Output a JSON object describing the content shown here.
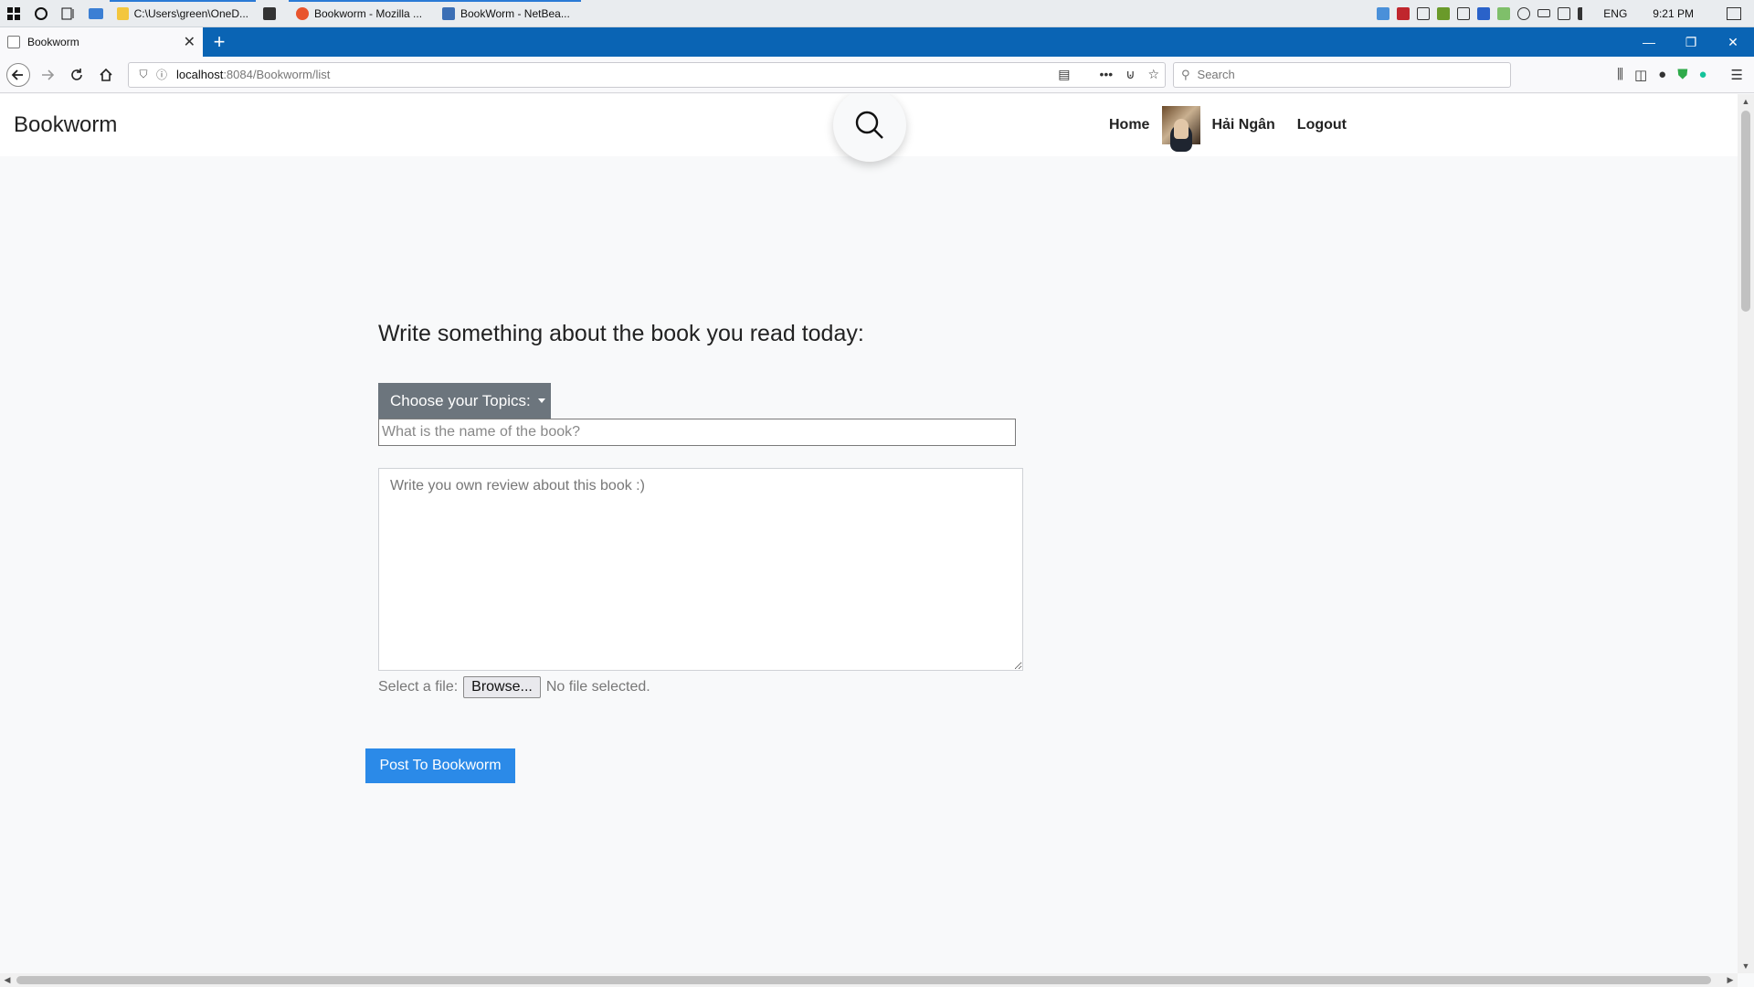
{
  "taskbar": {
    "apps": [
      {
        "label": "C:\\Users\\green\\OneD...",
        "icon": "folder-icon",
        "color": "#f3c63d",
        "active": true
      },
      {
        "label": "",
        "icon": "store-icon",
        "color": "#333333",
        "active": false
      },
      {
        "label": "Bookworm - Mozilla ...",
        "icon": "firefox-icon",
        "color": "#e8542d",
        "active": true
      },
      {
        "label": "BookWorm - NetBea...",
        "icon": "netbeans-icon",
        "color": "#3b6fb5",
        "active": true
      }
    ],
    "language": "ENG",
    "time": "9:21 PM"
  },
  "browser": {
    "tab_title": "Bookworm",
    "url_host": "localhost",
    "url_rest": ":8084/Bookworm/list",
    "search_placeholder": "Search"
  },
  "site": {
    "brand": "Bookworm",
    "nav": {
      "home": "Home",
      "user": "Hải Ngân",
      "logout": "Logout"
    }
  },
  "post_form": {
    "prompt": "Write something about the book you read today:",
    "topic_button": "Choose your Topics:",
    "book_placeholder": "What is the name of the book?",
    "review_placeholder": "Write you own review about this book :)",
    "file_label": "Select a file:",
    "browse_label": "Browse...",
    "file_status": "No file selected.",
    "submit_label": "Post To Bookworm"
  },
  "colors": {
    "tabstrip": "#0a64b4",
    "topic_button": "#6c757d",
    "submit_button": "#2b8ae8"
  }
}
